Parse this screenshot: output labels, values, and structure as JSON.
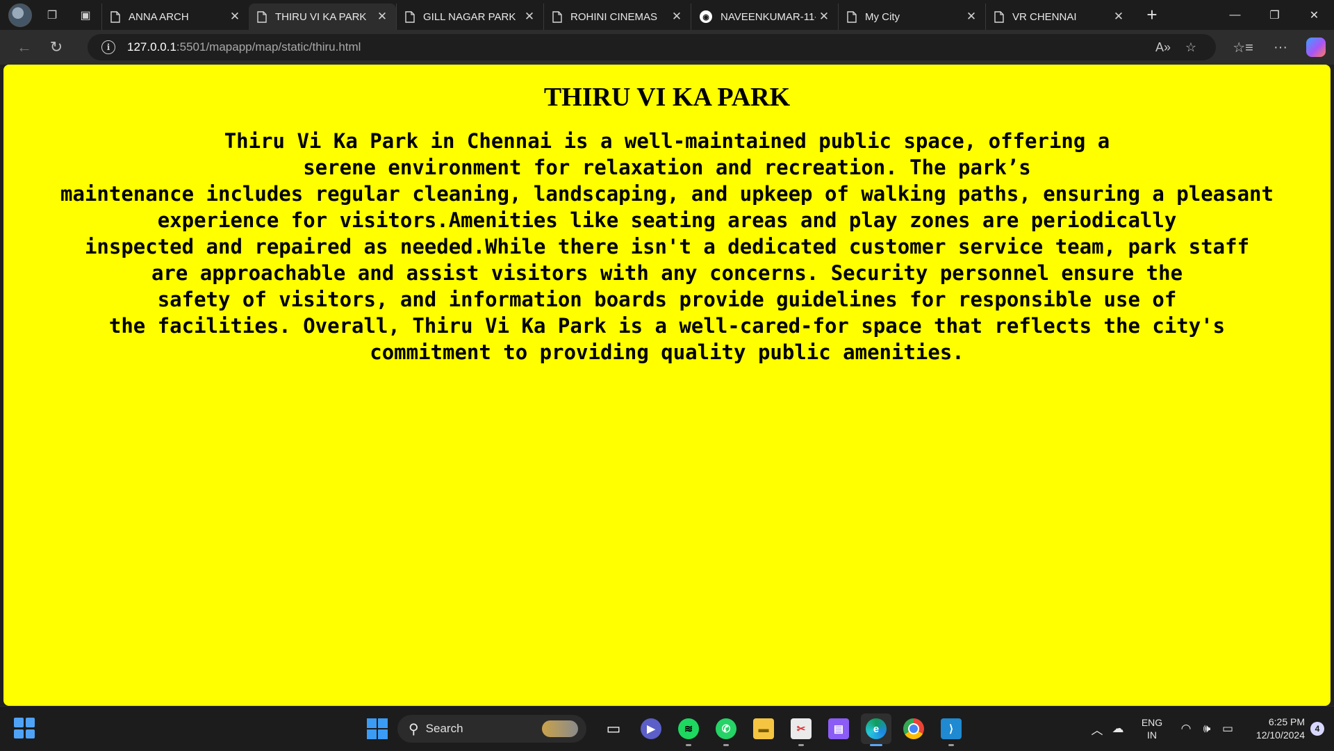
{
  "tabs": [
    {
      "label": "ANNA ARCH",
      "icon": "page-icon",
      "active": false
    },
    {
      "label": "THIRU VI KA PARK",
      "icon": "page-icon",
      "active": true
    },
    {
      "label": "GILL NAGAR PARK",
      "icon": "page-icon",
      "active": false
    },
    {
      "label": "ROHINI CINEMAS",
      "icon": "page-icon",
      "active": false
    },
    {
      "label": "NAVEENKUMAR-11-",
      "icon": "github-icon",
      "active": false
    },
    {
      "label": "My City",
      "icon": "page-icon",
      "active": false
    },
    {
      "label": "VR CHENNAI",
      "icon": "page-icon",
      "active": false
    }
  ],
  "address": {
    "host": "127.0.0.1",
    "rest": ":5501/mapapp/map/static/thiru.html"
  },
  "page": {
    "title": "THIRU VI KA PARK",
    "lines": [
      "Thiru Vi Ka Park in Chennai is a well-maintained public space, offering a",
      "serene environment for relaxation and recreation. The park’s",
      "maintenance includes regular cleaning, landscaping, and upkeep of walking paths, ensuring a pleasant",
      "experience for visitors.Amenities like seating areas and play zones are periodically",
      "inspected and repaired as needed.While there isn't a dedicated customer service team, park staff",
      "are approachable and assist visitors with any concerns. Security personnel ensure the",
      "safety of visitors, and information boards provide guidelines for responsible use of",
      "the facilities. Overall, Thiru Vi Ka Park is a well-cared-for space that reflects the city's",
      "commitment to providing quality public amenities."
    ],
    "background_color": "#ffff00"
  },
  "taskbar": {
    "search_label": "Search",
    "language": {
      "line1": "ENG",
      "line2": "IN"
    },
    "clock": {
      "time": "6:25 PM",
      "date": "12/10/2024"
    },
    "notification_count": "4"
  }
}
